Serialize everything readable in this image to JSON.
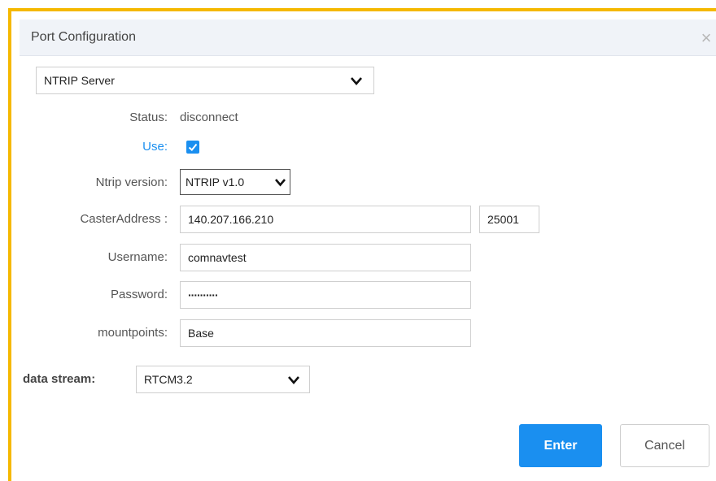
{
  "dialog": {
    "title": "Port Configuration",
    "close_glyph": "×"
  },
  "mode_select": {
    "value": "NTRIP Server"
  },
  "status": {
    "label": "Status:",
    "value": "disconnect"
  },
  "use": {
    "label": "Use:",
    "checked": true
  },
  "ntrip_version": {
    "label": "Ntrip version:",
    "value": "NTRIP v1.0"
  },
  "caster": {
    "label": "CasterAddress :",
    "address": "140.207.166.210",
    "port": "25001"
  },
  "username": {
    "label": "Username:",
    "value": "comnavtest"
  },
  "password": {
    "label": "Password:",
    "value": "··········"
  },
  "mountpoints": {
    "label": "mountpoints:",
    "value": "Base"
  },
  "data_stream": {
    "label": "data stream:",
    "value": "RTCM3.2"
  },
  "buttons": {
    "enter": "Enter",
    "cancel": "Cancel"
  },
  "icons": {
    "chevron": "chevron-down-icon",
    "check": "check-icon",
    "close": "close-icon"
  },
  "colors": {
    "accent": "#1a8ff0",
    "frame": "#f5b800"
  }
}
